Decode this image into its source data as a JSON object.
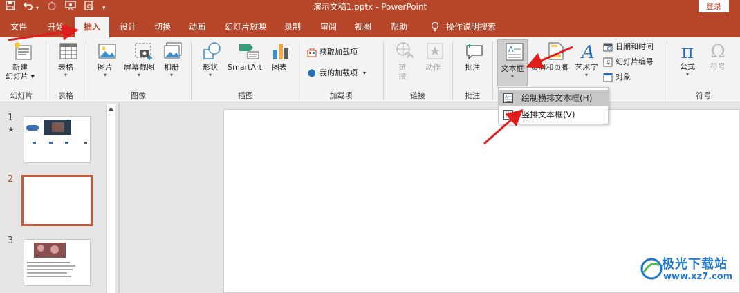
{
  "app": {
    "title": "演示文稿1.pptx  -  PowerPoint",
    "login": "登录"
  },
  "qat": {
    "save_icon": "save-icon",
    "undo_icon": "undo-icon",
    "redo_icon": "redo-icon",
    "present_icon": "present-from-start-icon",
    "preview_icon": "print-preview-icon",
    "customize_icon": "customize-qat-icon"
  },
  "tabs": [
    {
      "label": "文件"
    },
    {
      "label": "开始"
    },
    {
      "label": "插入"
    },
    {
      "label": "设计"
    },
    {
      "label": "切换"
    },
    {
      "label": "动画"
    },
    {
      "label": "幻灯片放映"
    },
    {
      "label": "录制"
    },
    {
      "label": "审阅"
    },
    {
      "label": "视图"
    },
    {
      "label": "帮助"
    },
    {
      "label": "操作说明搜索"
    }
  ],
  "ribbon": {
    "new_slide": {
      "label1": "新建",
      "label2": "幻灯片"
    },
    "table": {
      "label": "表格"
    },
    "picture": {
      "label": "图片"
    },
    "screenshot": {
      "label": "屏幕截图"
    },
    "album": {
      "label": "相册"
    },
    "shapes": {
      "label": "形状"
    },
    "smartart": {
      "label": "SmartArt"
    },
    "chart": {
      "label": "图表"
    },
    "get_addins": {
      "label": "获取加载项"
    },
    "my_addins": {
      "label": "我的加载项"
    },
    "link": {
      "label1": "链",
      "label2": "接"
    },
    "action": {
      "label": "动作"
    },
    "comment": {
      "label": "批注"
    },
    "textbox": {
      "label": "文本框"
    },
    "header_footer": {
      "label": "页眉和页脚"
    },
    "wordart": {
      "label": "艺术字"
    },
    "datetime": {
      "label": "日期和时间"
    },
    "slide_number": {
      "label": "幻灯片编号"
    },
    "object": {
      "label": "对象"
    },
    "equation": {
      "label": "公式"
    },
    "symbol": {
      "label": "符号"
    },
    "groups": {
      "slides": "幻灯片",
      "tables": "表格",
      "images": "图像",
      "illustrations": "插图",
      "addins": "加载项",
      "links": "链接",
      "comments": "批注",
      "symbols": "符号"
    }
  },
  "dropdown": {
    "items": [
      {
        "label": "绘制横排文本框(H)"
      },
      {
        "label": "竖排文本框(V)"
      }
    ]
  },
  "slides": {
    "numbers": [
      "1",
      "2",
      "3"
    ],
    "star": "★"
  },
  "watermark": {
    "name": "极光下载站",
    "url": "www.xz7.com"
  },
  "colors": {
    "brand": "#b7472a",
    "arrow": "#e01e1e"
  }
}
